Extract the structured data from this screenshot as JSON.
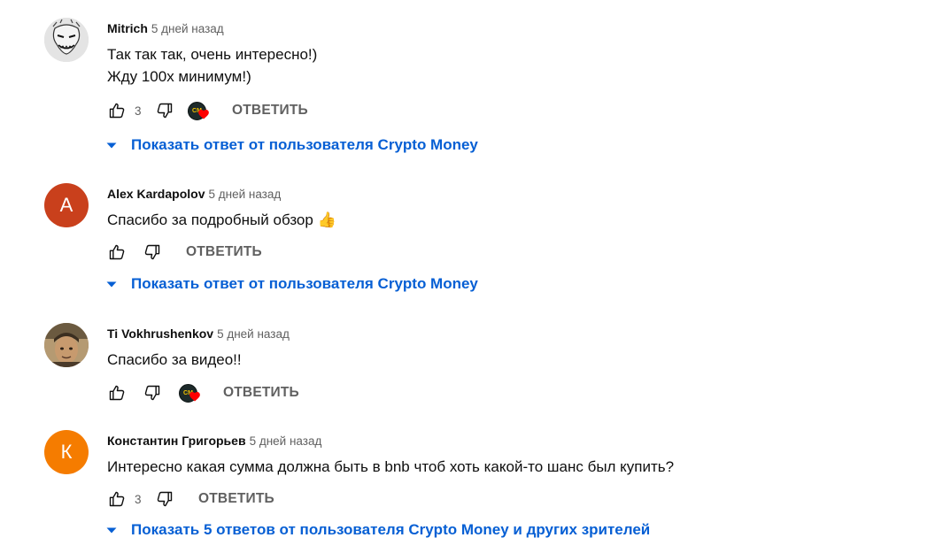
{
  "comments": [
    {
      "author": "Mitrich",
      "time": "5 дней назад",
      "lines": [
        "Так так так, очень интересно!)",
        "Жду 100x минимум!)"
      ],
      "likes": "3",
      "creator_heart": true,
      "creator_initials": "CM",
      "reply_label": "ОТВЕТИТЬ",
      "replies_label": "Показать ответ от пользователя Crypto Money"
    },
    {
      "author": "Alex Kardapolov",
      "time": "5 дней назад",
      "avatar_letter": "A",
      "avatar_color": "#c9401c",
      "lines": [
        "Спасибо за подробный обзор 👍"
      ],
      "likes": "",
      "creator_heart": false,
      "reply_label": "ОТВЕТИТЬ",
      "replies_label": "Показать ответ от пользователя Crypto Money"
    },
    {
      "author": "Ti Vokhrushenkov",
      "time": "5 дней назад",
      "lines": [
        "Спасибо за видео!!"
      ],
      "likes": "",
      "creator_heart": true,
      "creator_initials": "CM",
      "reply_label": "ОТВЕТИТЬ"
    },
    {
      "author": "Константин Григорьев",
      "time": "5 дней назад",
      "avatar_letter": "К",
      "avatar_color": "#f57c00",
      "lines": [
        "Интересно какая сумма должна быть в bnb чтоб хоть какой-то шанс был купить?"
      ],
      "likes": "3",
      "creator_heart": false,
      "reply_label": "ОТВЕТИТЬ",
      "replies_label": "Показать 5 ответов от пользователя Crypto Money и других зрителей"
    }
  ],
  "colors": {
    "link": "#065fd4",
    "muted": "#606060",
    "heart": "#ff0000"
  },
  "icons": [
    "like-icon",
    "dislike-icon",
    "heart-icon",
    "caret-down-icon"
  ]
}
